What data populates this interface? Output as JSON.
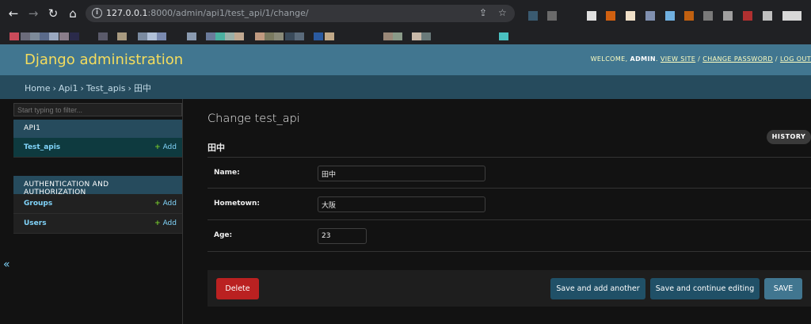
{
  "browser": {
    "url_host": "127.0.0.1",
    "url_rest": ":8000/admin/api1/test_api/1/change/",
    "bookmark_colors": [
      "#c94b5a",
      "#6b6b7a",
      "#7d8a99",
      "#5a6a8a",
      "#9aa8c0",
      "#8a7d8a",
      "#2a2a4a",
      "#5a5a6a",
      "#a89a80",
      "#7a8aa0",
      "#b0c0d8",
      "#7a8ab0",
      "#8a9ab0",
      "#6a7a9a",
      "#4ab0a0",
      "#9ab0a8",
      "#c0a890",
      "#c09a80",
      "#7a7a60",
      "#8a8a78",
      "#3a4a5a",
      "#5a6a7a",
      "#2a5aa0",
      "#c0a888",
      "#9a8878",
      "#8a9a88",
      "#c8b8a8",
      "#6a7a7a",
      "#4ac0c0"
    ],
    "extension_colors": [
      "#3a5a70",
      "#6a6a6a",
      "#e0e0e0",
      "#d06010",
      "#f0e0c8",
      "#8090b0",
      "#70b0e0",
      "#c06010",
      "#7a7a7a",
      "#a0a0a0",
      "#b03030",
      "#c0c0c0",
      "#d8d8d8"
    ]
  },
  "header": {
    "brand": "Django administration",
    "welcome": "WELCOME,",
    "username": "ADMIN",
    "view_site": "VIEW SITE",
    "change_password": "CHANGE PASSWORD",
    "log_out": "LOG OUT"
  },
  "breadcrumbs": [
    "Home",
    "Api1",
    "Test_apis",
    "田中"
  ],
  "sidebar": {
    "filter_placeholder": "Start typing to filter...",
    "apps": [
      {
        "name": "API1",
        "models": [
          {
            "label": "Test_apis",
            "add": "Add"
          }
        ]
      },
      {
        "name": "AUTHENTICATION AND AUTHORIZATION",
        "models": [
          {
            "label": "Groups",
            "add": "Add"
          },
          {
            "label": "Users",
            "add": "Add"
          }
        ]
      }
    ],
    "collapse_icon": "«"
  },
  "content": {
    "title": "Change test_api",
    "object_title": "田中",
    "history_label": "HISTORY",
    "fields": [
      {
        "label": "Name:",
        "value": "田中"
      },
      {
        "label": "Hometown:",
        "value": "大阪"
      },
      {
        "label": "Age:",
        "value": "23"
      }
    ]
  },
  "actions": {
    "delete": "Delete",
    "save_add_another": "Save and add another",
    "save_continue": "Save and continue editing",
    "save": "SAVE"
  },
  "colors": {
    "header_bg": "#417690",
    "brand": "#f5dd5d",
    "breadcrumb_bg": "#264b5d",
    "link": "#81d4fa",
    "delete_bg": "#ba2121",
    "save_bg": "#417690"
  }
}
